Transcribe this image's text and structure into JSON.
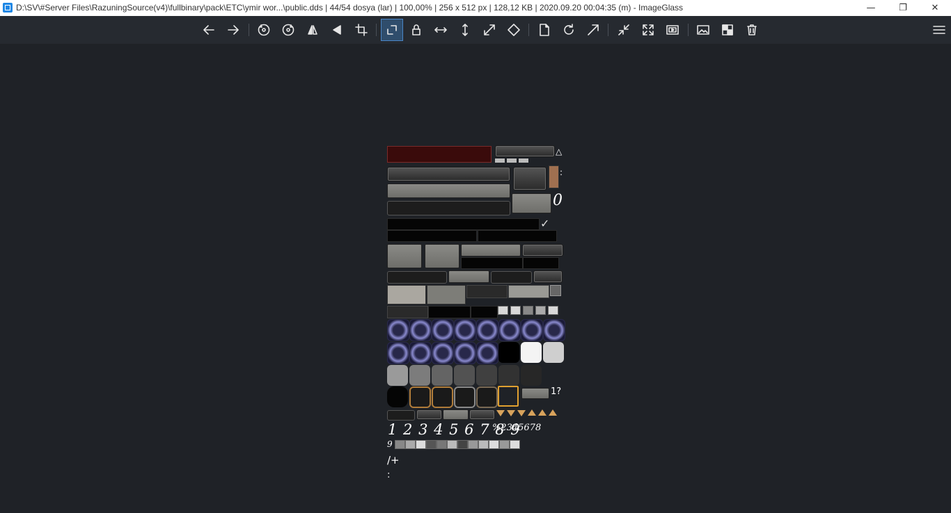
{
  "window": {
    "title": "D:\\SV\\#Server Files\\RazuningSource(v4)\\fullbinary\\pack\\ETC\\ymir wor...\\public.dds  |  44/54 dosya (lar)  |  100,00%  |  256 x 512 px  |  128,12 KB  |  2020.09.20 00:04:35 (m)  - ImageGlass",
    "minimize_glyph": "—",
    "restore_glyph": "❐",
    "close_glyph": "✕"
  },
  "toolbar": {
    "buttons": [
      {
        "name": "back-icon"
      },
      {
        "name": "forward-icon"
      },
      {
        "name": "rotate-left-icon"
      },
      {
        "name": "rotate-right-icon"
      },
      {
        "name": "flip-horizontal-icon"
      },
      {
        "name": "flip-vertical-icon"
      },
      {
        "name": "crop-icon"
      },
      {
        "name": "auto-zoom-icon",
        "active": true
      },
      {
        "name": "lock-zoom-icon"
      },
      {
        "name": "scale-width-icon"
      },
      {
        "name": "scale-height-icon"
      },
      {
        "name": "scale-to-fit-icon"
      },
      {
        "name": "scale-to-fill-icon"
      },
      {
        "name": "open-file-icon"
      },
      {
        "name": "refresh-icon"
      },
      {
        "name": "go-to-icon"
      },
      {
        "name": "thumbnail-icon"
      },
      {
        "name": "fullscreen-icon"
      },
      {
        "name": "slideshow-icon"
      },
      {
        "name": "set-wallpaper-icon"
      },
      {
        "name": "checkerboard-icon"
      },
      {
        "name": "delete-icon"
      },
      {
        "name": "menu-icon"
      }
    ]
  },
  "image_content": {
    "row_digits_large": "1 2 3 4 5 6 7 8 9",
    "percent_small": "%2345678",
    "zero_glyph": "0",
    "glyph_a": "9",
    "slash_plus": "/+",
    "colon": ":",
    "question": "1?"
  },
  "colors": {
    "background": "#1f2227",
    "toolbar": "#262a30",
    "active_button": "#2f4d6c",
    "accent": "#4a86c7"
  }
}
